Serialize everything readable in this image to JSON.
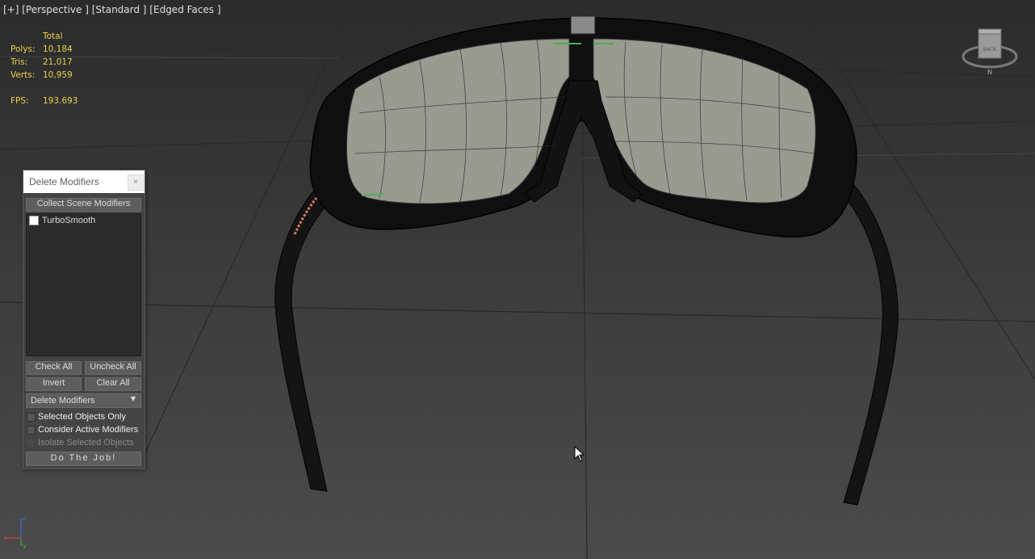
{
  "viewport": {
    "label": "[+] [Perspective ] [Standard ] [Edged Faces ]"
  },
  "stats": {
    "header": "Total",
    "polys_label": "Polys:",
    "polys_value": "10,184",
    "tris_label": "Tris:",
    "tris_value": "21,017",
    "verts_label": "Verts:",
    "verts_value": "10,959",
    "fps_label": "FPS:",
    "fps_value": "193.693"
  },
  "dialog": {
    "title": "Delete Modifiers",
    "close_label": "×",
    "collect_button": "Collect Scene Modifiers",
    "list_items": [
      {
        "label": "TurboSmooth",
        "checked": false
      }
    ],
    "check_all": "Check All",
    "uncheck_all": "Uncheck All",
    "invert": "Invert",
    "clear_all": "Clear All",
    "mode_dropdown": "Delete Modifiers",
    "selected_objects_only": "Selected Objects Only",
    "consider_active_modifiers": "Consider Active Modifiers",
    "isolate_selected_objects": "Isolate Selected Objects",
    "do_the_job": "Do The Job!"
  },
  "viewcube": {
    "face_label": "BACK",
    "compass_label": "N"
  },
  "axis_gizmo": {
    "z": "z",
    "x": "x",
    "y": "y"
  },
  "colors": {
    "stats_text": "#e8d24a",
    "dialog_bg": "#444444",
    "button_bg": "#5d5d5d",
    "wire_color": "#000000",
    "lens_color": "#9a9b90"
  }
}
